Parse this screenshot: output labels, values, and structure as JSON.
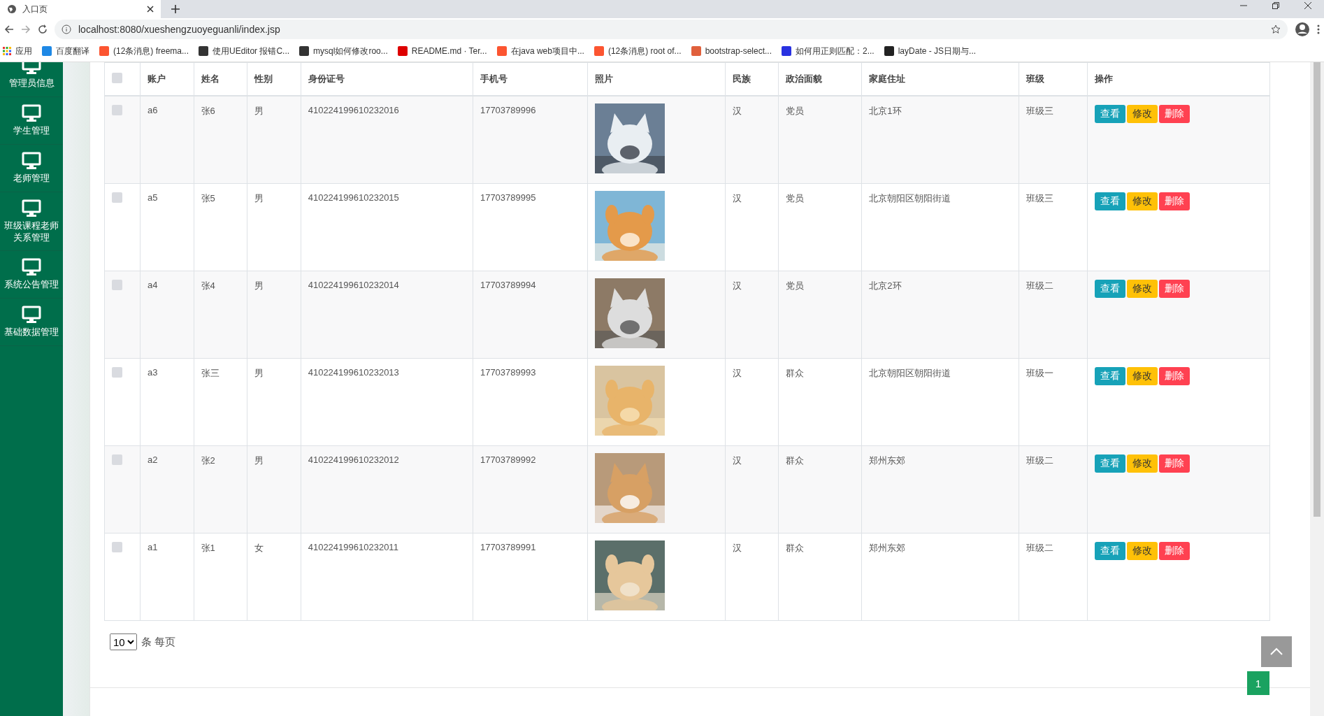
{
  "browser": {
    "tab": {
      "title": "入口页"
    },
    "url": "localhost:8080/xueshengzuoyeguanli/index.jsp",
    "bookmarks": [
      {
        "label": "应用"
      },
      {
        "label": "百度翻译"
      },
      {
        "label": "(12条消息) freema..."
      },
      {
        "label": "使用UEditor 报错C..."
      },
      {
        "label": "mysql如何修改roo..."
      },
      {
        "label": "README.md · Ter..."
      },
      {
        "label": "在java web项目中..."
      },
      {
        "label": "(12条消息) root of..."
      },
      {
        "label": "bootstrap-select..."
      },
      {
        "label": "如何用正则匹配：2..."
      },
      {
        "label": "layDate - JS日期与..."
      }
    ]
  },
  "sidebar": {
    "items": [
      {
        "label": "管理员信息"
      },
      {
        "label": "学生管理"
      },
      {
        "label": "老师管理"
      },
      {
        "label": "班级课程老师关系管理"
      },
      {
        "label": "系统公告管理"
      },
      {
        "label": "基础数据管理"
      }
    ]
  },
  "table": {
    "select_all": {
      "checked": false
    },
    "columns": [
      "账户",
      "姓名",
      "性别",
      "身份证号",
      "手机号",
      "照片",
      "民族",
      "政治面貌",
      "家庭住址",
      "班级",
      "操作"
    ],
    "rows": [
      {
        "checked": false,
        "cells": [
          "a6",
          "张6",
          "男",
          "410224199610232016",
          "17703789996",
          {
            "kind": "picture"
          },
          "汉",
          "党员",
          "北京1环",
          "班级三"
        ],
        "actions": [
          {
            "kind": "view",
            "label": "查看"
          },
          {
            "kind": "edit",
            "label": "修改"
          },
          {
            "kind": "delete",
            "label": "删除"
          }
        ]
      },
      {
        "checked": false,
        "cells": [
          "a5",
          "张5",
          "男",
          "410224199610232015",
          "17703789995",
          {
            "kind": "picture"
          },
          "汉",
          "党员",
          "北京朝阳区朝阳街道",
          "班级三"
        ],
        "actions": [
          {
            "kind": "view",
            "label": "查看"
          },
          {
            "kind": "edit",
            "label": "修改"
          },
          {
            "kind": "delete",
            "label": "删除"
          }
        ]
      },
      {
        "checked": false,
        "cells": [
          "a4",
          "张4",
          "男",
          "410224199610232014",
          "17703789994",
          {
            "kind": "picture"
          },
          "汉",
          "党员",
          "北京2环",
          "班级二"
        ],
        "actions": [
          {
            "kind": "view",
            "label": "查看"
          },
          {
            "kind": "edit",
            "label": "修改"
          },
          {
            "kind": "delete",
            "label": "删除"
          }
        ]
      },
      {
        "checked": false,
        "cells": [
          "a3",
          "张三",
          "男",
          "410224199610232013",
          "17703789993",
          {
            "kind": "picture"
          },
          "汉",
          "群众",
          "北京朝阳区朝阳街道",
          "班级一"
        ],
        "actions": [
          {
            "kind": "view",
            "label": "查看"
          },
          {
            "kind": "edit",
            "label": "修改"
          },
          {
            "kind": "delete",
            "label": "删除"
          }
        ]
      },
      {
        "checked": false,
        "cells": [
          "a2",
          "张2",
          "男",
          "410224199610232012",
          "17703789992",
          {
            "kind": "picture"
          },
          "汉",
          "群众",
          "郑州东郊",
          "班级二"
        ],
        "actions": [
          {
            "kind": "view",
            "label": "查看"
          },
          {
            "kind": "edit",
            "label": "修改"
          },
          {
            "kind": "delete",
            "label": "删除"
          }
        ]
      },
      {
        "checked": false,
        "cells": [
          "a1",
          "张1",
          "女",
          "410224199610232011",
          "17703789991",
          {
            "kind": "picture"
          },
          "汉",
          "群众",
          "郑州东郊",
          "班级二"
        ],
        "actions": [
          {
            "kind": "view",
            "label": "查看"
          },
          {
            "kind": "edit",
            "label": "修改"
          },
          {
            "kind": "delete",
            "label": "删除"
          }
        ]
      }
    ]
  },
  "pagination": {
    "page_size": "10",
    "page_size_suffix": "条 每页",
    "current_page": "1"
  }
}
